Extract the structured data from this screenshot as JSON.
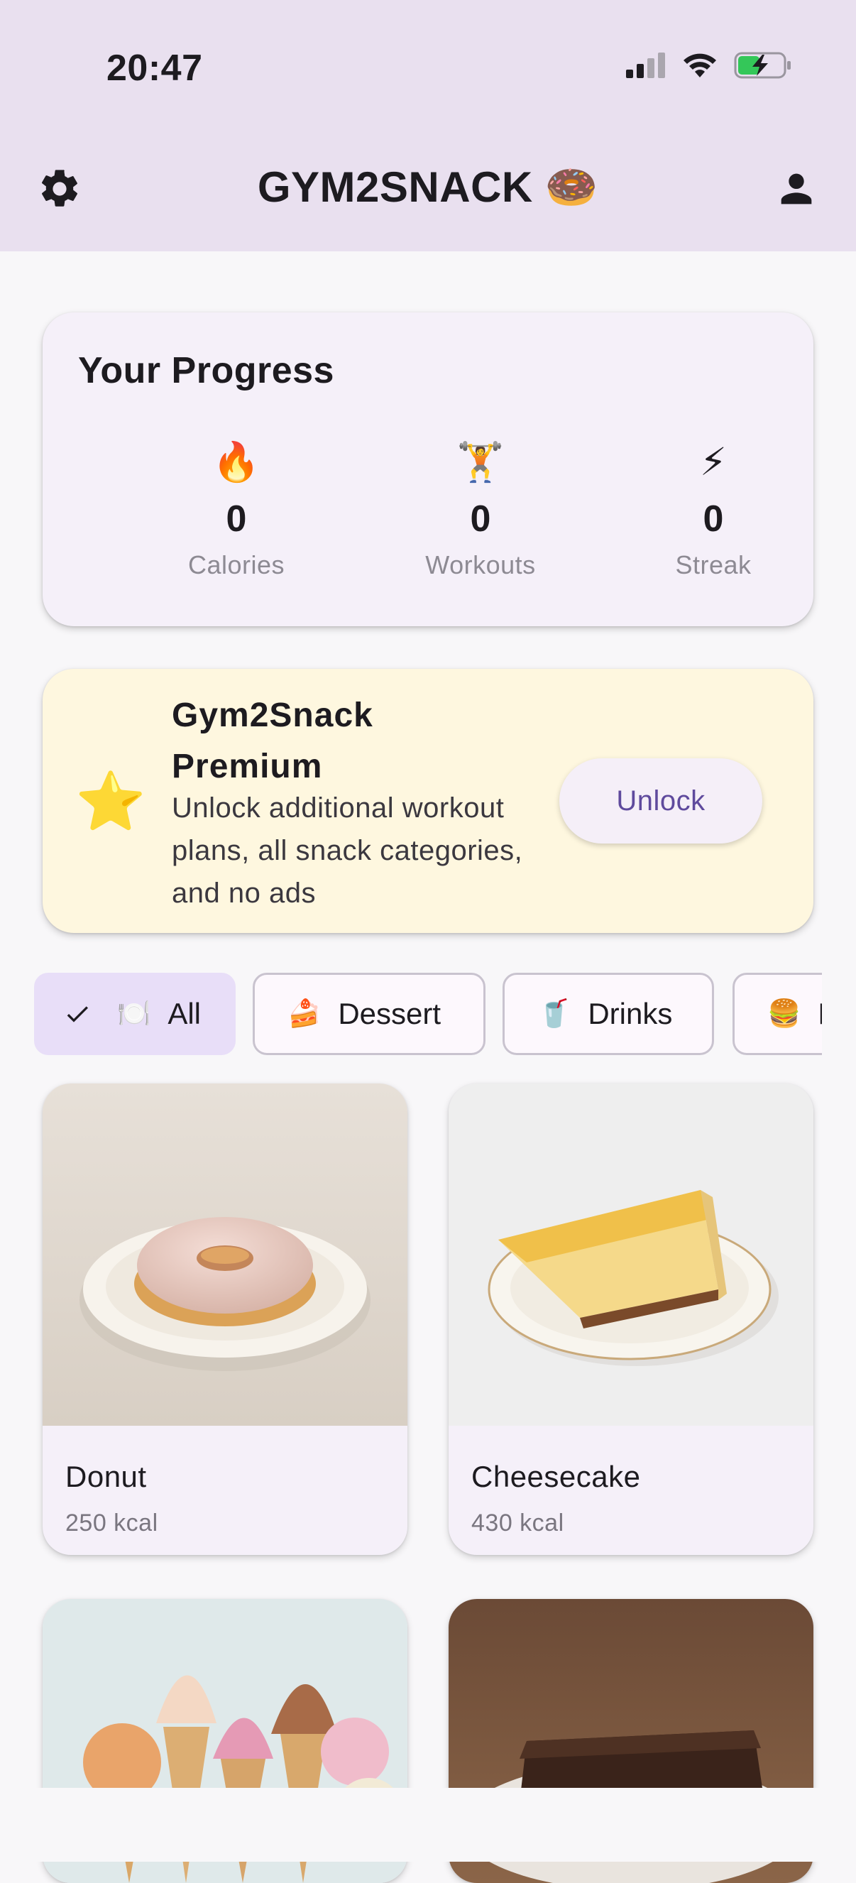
{
  "status_bar": {
    "time": "20:47"
  },
  "app_bar": {
    "title": "GYM2SNACK 🍩"
  },
  "progress": {
    "title": "Your Progress",
    "stats": [
      {
        "emoji": "🔥",
        "value": "0",
        "label": "Calories"
      },
      {
        "emoji": "🏋️",
        "value": "0",
        "label": "Workouts"
      },
      {
        "emoji": "⚡",
        "value": "0",
        "label": "Streak"
      }
    ]
  },
  "premium": {
    "icon": "⭐",
    "title": "Gym2Snack Premium",
    "description": "Unlock additional workout plans, all snack categories, and no ads",
    "button_label": "Unlock"
  },
  "categories": [
    {
      "emoji": "🍽️",
      "label": "All",
      "selected": true
    },
    {
      "emoji": "🍰",
      "label": "Dessert",
      "selected": false
    },
    {
      "emoji": "🥤",
      "label": "Drinks",
      "selected": false
    },
    {
      "emoji": "🍔",
      "label": "F",
      "selected": false
    }
  ],
  "snacks": [
    {
      "name": "Donut",
      "kcal": "250 kcal"
    },
    {
      "name": "Cheesecake",
      "kcal": "430 kcal"
    },
    {
      "name": "",
      "kcal": ""
    },
    {
      "name": "",
      "kcal": ""
    }
  ],
  "colors": {
    "header_bg": "#e9e0ef",
    "progress_card_bg": "#f5f0f9",
    "premium_card_bg": "#fef7df",
    "accent": "#5f4a9d",
    "chip_selected_bg": "#e8def8"
  }
}
